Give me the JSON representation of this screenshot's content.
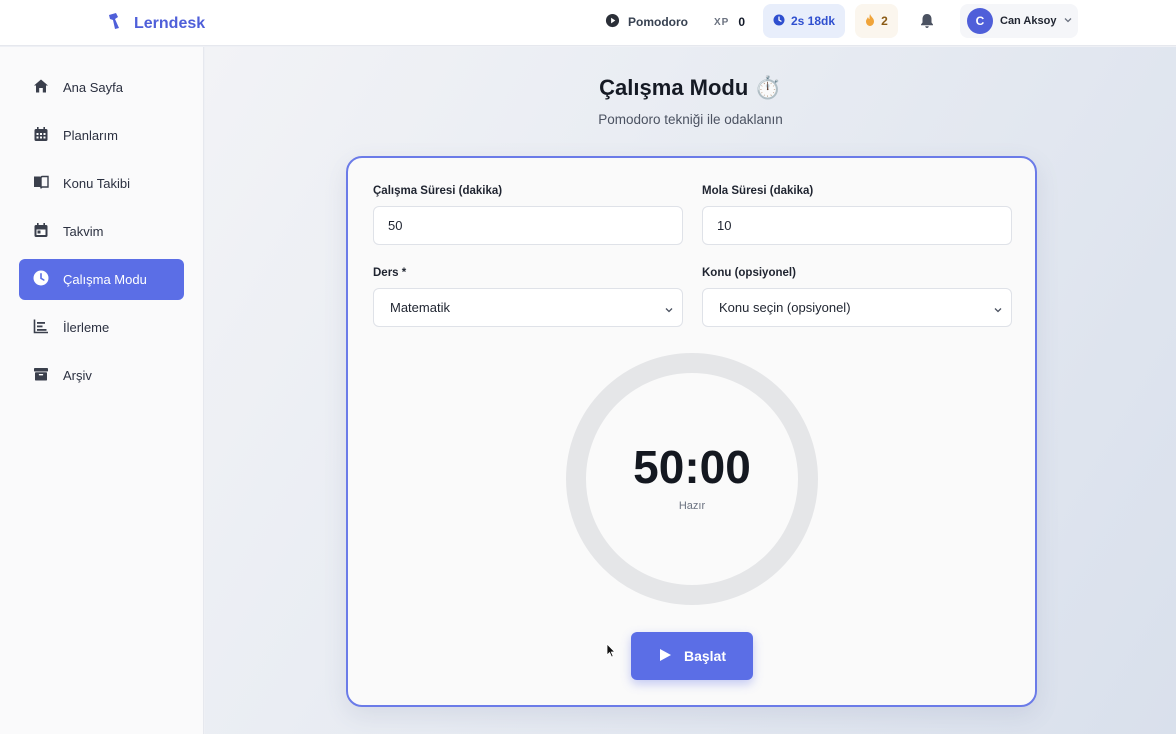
{
  "app": {
    "name": "Lerndesk"
  },
  "topbar": {
    "pomodoro_label": "Pomodoro",
    "xp_label": "XP",
    "xp_value": "0",
    "study_time": "2s 18dk",
    "streak": "2",
    "user_initial": "C",
    "user_name": "Can Aksoy"
  },
  "sidebar": {
    "items": [
      {
        "label": "Ana Sayfa",
        "icon": "home-icon"
      },
      {
        "label": "Planlarım",
        "icon": "calendar-grid-icon"
      },
      {
        "label": "Konu Takibi",
        "icon": "book-icon"
      },
      {
        "label": "Takvim",
        "icon": "calendar-icon"
      },
      {
        "label": "Çalışma Modu",
        "icon": "clock-icon",
        "active": true
      },
      {
        "label": "İlerleme",
        "icon": "chart-icon"
      },
      {
        "label": "Arşiv",
        "icon": "archive-icon"
      }
    ]
  },
  "page": {
    "title": "Çalışma Modu ⏱️",
    "subtitle": "Pomodoro tekniği ile odaklanın"
  },
  "form": {
    "work_label": "Çalışma Süresi (dakika)",
    "work_value": "50",
    "break_label": "Mola Süresi (dakika)",
    "break_value": "10",
    "subject_label": "Ders *",
    "subject_value": "Matematik",
    "topic_label": "Konu (opsiyonel)",
    "topic_value": "Konu seçin (opsiyonel)"
  },
  "timer": {
    "display": "50:00",
    "status": "Hazır"
  },
  "actions": {
    "start_label": "Başlat"
  },
  "colors": {
    "accent": "#5b6ee6",
    "brand": "#4f5fd9",
    "ring": "#e5e6e8"
  }
}
